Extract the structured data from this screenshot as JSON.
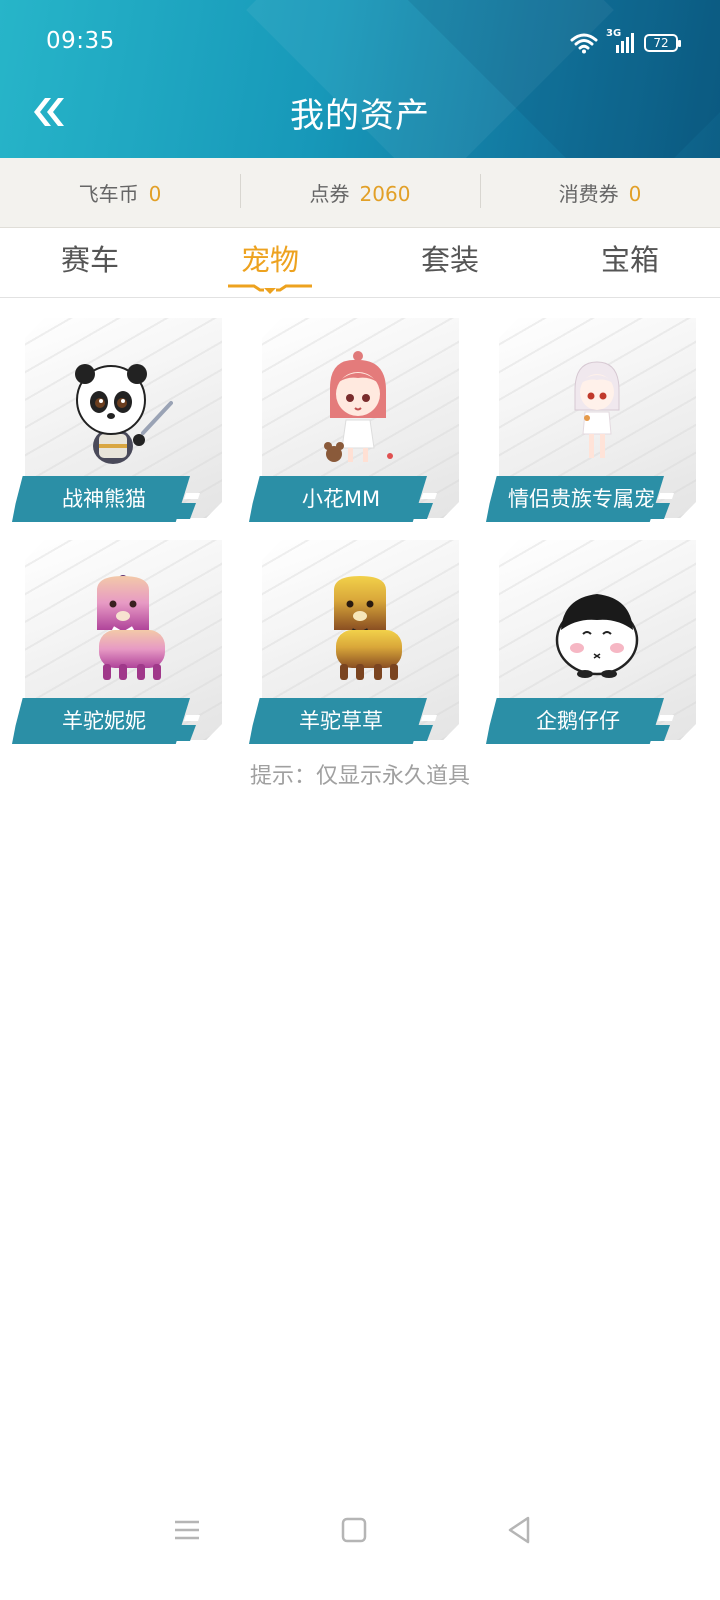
{
  "status_bar": {
    "time": "09:35",
    "network": "3G",
    "battery": "72",
    "icons": [
      "wifi-icon",
      "signal-icon",
      "battery-icon"
    ]
  },
  "header": {
    "title": "我的资产",
    "back_icon": "double-chevron-left-icon"
  },
  "currencies": [
    {
      "label": "飞车币",
      "value": "0"
    },
    {
      "label": "点券",
      "value": "2060"
    },
    {
      "label": "消费券",
      "value": "0"
    }
  ],
  "tabs": [
    {
      "label": "赛车",
      "active": false
    },
    {
      "label": "宠物",
      "active": true
    },
    {
      "label": "套装",
      "active": false
    },
    {
      "label": "宝箱",
      "active": false
    }
  ],
  "pets": [
    {
      "name": "战神熊猫",
      "icon": "panda-warrior-icon"
    },
    {
      "name": "小花MM",
      "icon": "girl-pink-hair-icon"
    },
    {
      "name": "情侣贵族专属宠",
      "icon": "girl-white-hair-icon"
    },
    {
      "name": "羊驼妮妮",
      "icon": "alpaca-pink-icon"
    },
    {
      "name": "羊驼草草",
      "icon": "alpaca-yellow-icon"
    },
    {
      "name": "企鹅仔仔",
      "icon": "penguin-icon"
    }
  ],
  "hint": "提示：仅显示永久道具",
  "colors": {
    "accent": "#eda21f",
    "header_start": "#27b5c9",
    "header_end": "#0d5f86",
    "banner": "#2b8fa6"
  },
  "nav_bar": [
    "menu-icon",
    "home-icon",
    "back-icon"
  ]
}
